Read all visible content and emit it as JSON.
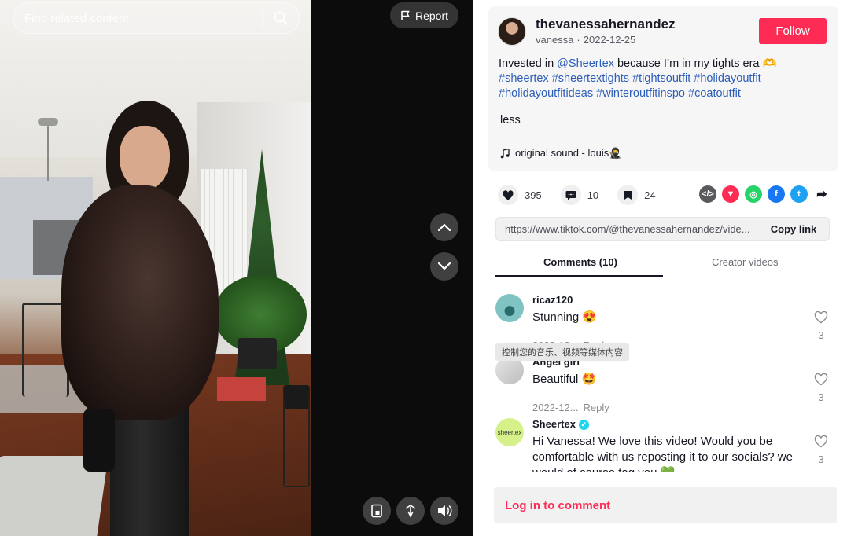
{
  "video": {
    "search_placeholder": "Find related content",
    "report_label": "Report"
  },
  "author": {
    "username": "thevanessahernandez",
    "nickname": "vanessa",
    "date": "2022-12-25",
    "follow_label": "Follow"
  },
  "post": {
    "text_before": "Invested in ",
    "mention": "@Sheertex",
    "text_after": " because I’m in my tights era 🫶",
    "hashtags": "#sheertex #sheertextights #tightsoutfit #holidayoutfit #holidayoutfitideas #winteroutfitinspo #coatoutfit",
    "less_label": "less",
    "music": "original sound - louis🥷"
  },
  "stats": {
    "likes": "395",
    "comments": "10",
    "saves": "24"
  },
  "link": {
    "url": "https://www.tiktok.com/@thevanessahernandez/vide...",
    "copy_label": "Copy link"
  },
  "tabs": {
    "comments": "Comments (10)",
    "creator": "Creator videos"
  },
  "comments": [
    {
      "name": "ricaz120",
      "text": "Stunning 😍",
      "date": "2022-12...",
      "reply": "Reply",
      "likes": "3"
    },
    {
      "name": "Angel girl",
      "text": "Beautiful 🤩",
      "date": "2022-12...",
      "reply": "Reply",
      "likes": "3"
    },
    {
      "name": "Sheertex",
      "text": "Hi Vanessa! We love this video! Would you be comfortable with us reposting it to our socials? we would of course tag you 💚",
      "likes": "3"
    }
  ],
  "tooltip": "控制您的音乐、视频等媒体内容",
  "login_label": "Log in to comment",
  "colors": {
    "accent": "#fe2c55",
    "link": "#2b5db9",
    "verified": "#20d5ec"
  }
}
